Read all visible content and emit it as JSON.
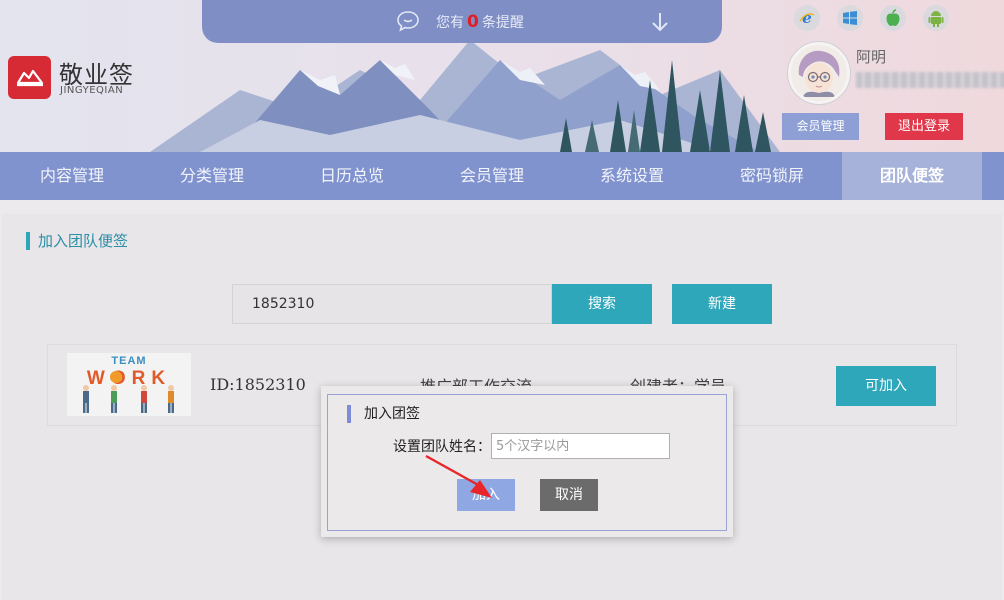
{
  "header": {
    "brand_cn": "敬业签",
    "brand_en": "JINGYEQIAN",
    "notice": {
      "prefix": "您有",
      "count": "0",
      "suffix": "条提醒"
    },
    "user": {
      "name": "阿明",
      "member_btn": "会员管理",
      "logout_btn": "退出登录"
    },
    "os_icons": [
      "ie-icon",
      "windows-icon",
      "apple-icon",
      "android-icon"
    ]
  },
  "nav": {
    "items": [
      {
        "label": "内容管理"
      },
      {
        "label": "分类管理"
      },
      {
        "label": "日历总览"
      },
      {
        "label": "会员管理"
      },
      {
        "label": "系统设置"
      },
      {
        "label": "密码锁屏"
      },
      {
        "label": "团队便签",
        "active": true
      }
    ]
  },
  "main": {
    "section_title": "加入团队便签",
    "search": {
      "value": "1852310",
      "search_btn": "搜索",
      "new_btn": "新建"
    },
    "team": {
      "logo_text_top": "TEAM",
      "logo_text_main": "WORK",
      "id_text": "ID:1852310",
      "desc": "推广部工作交流",
      "creator": "创建者：学员",
      "join_btn": "可加入"
    }
  },
  "dialog": {
    "title": "加入团签",
    "field_label": "设置团队姓名：",
    "placeholder": "5个汉字以内",
    "join_btn": "加入",
    "cancel_btn": "取消"
  },
  "colors": {
    "nav_bg": "#8193cf",
    "accent_teal": "#2ea7ba",
    "logout_red": "#e0384a",
    "brand_red": "#d62b34"
  }
}
